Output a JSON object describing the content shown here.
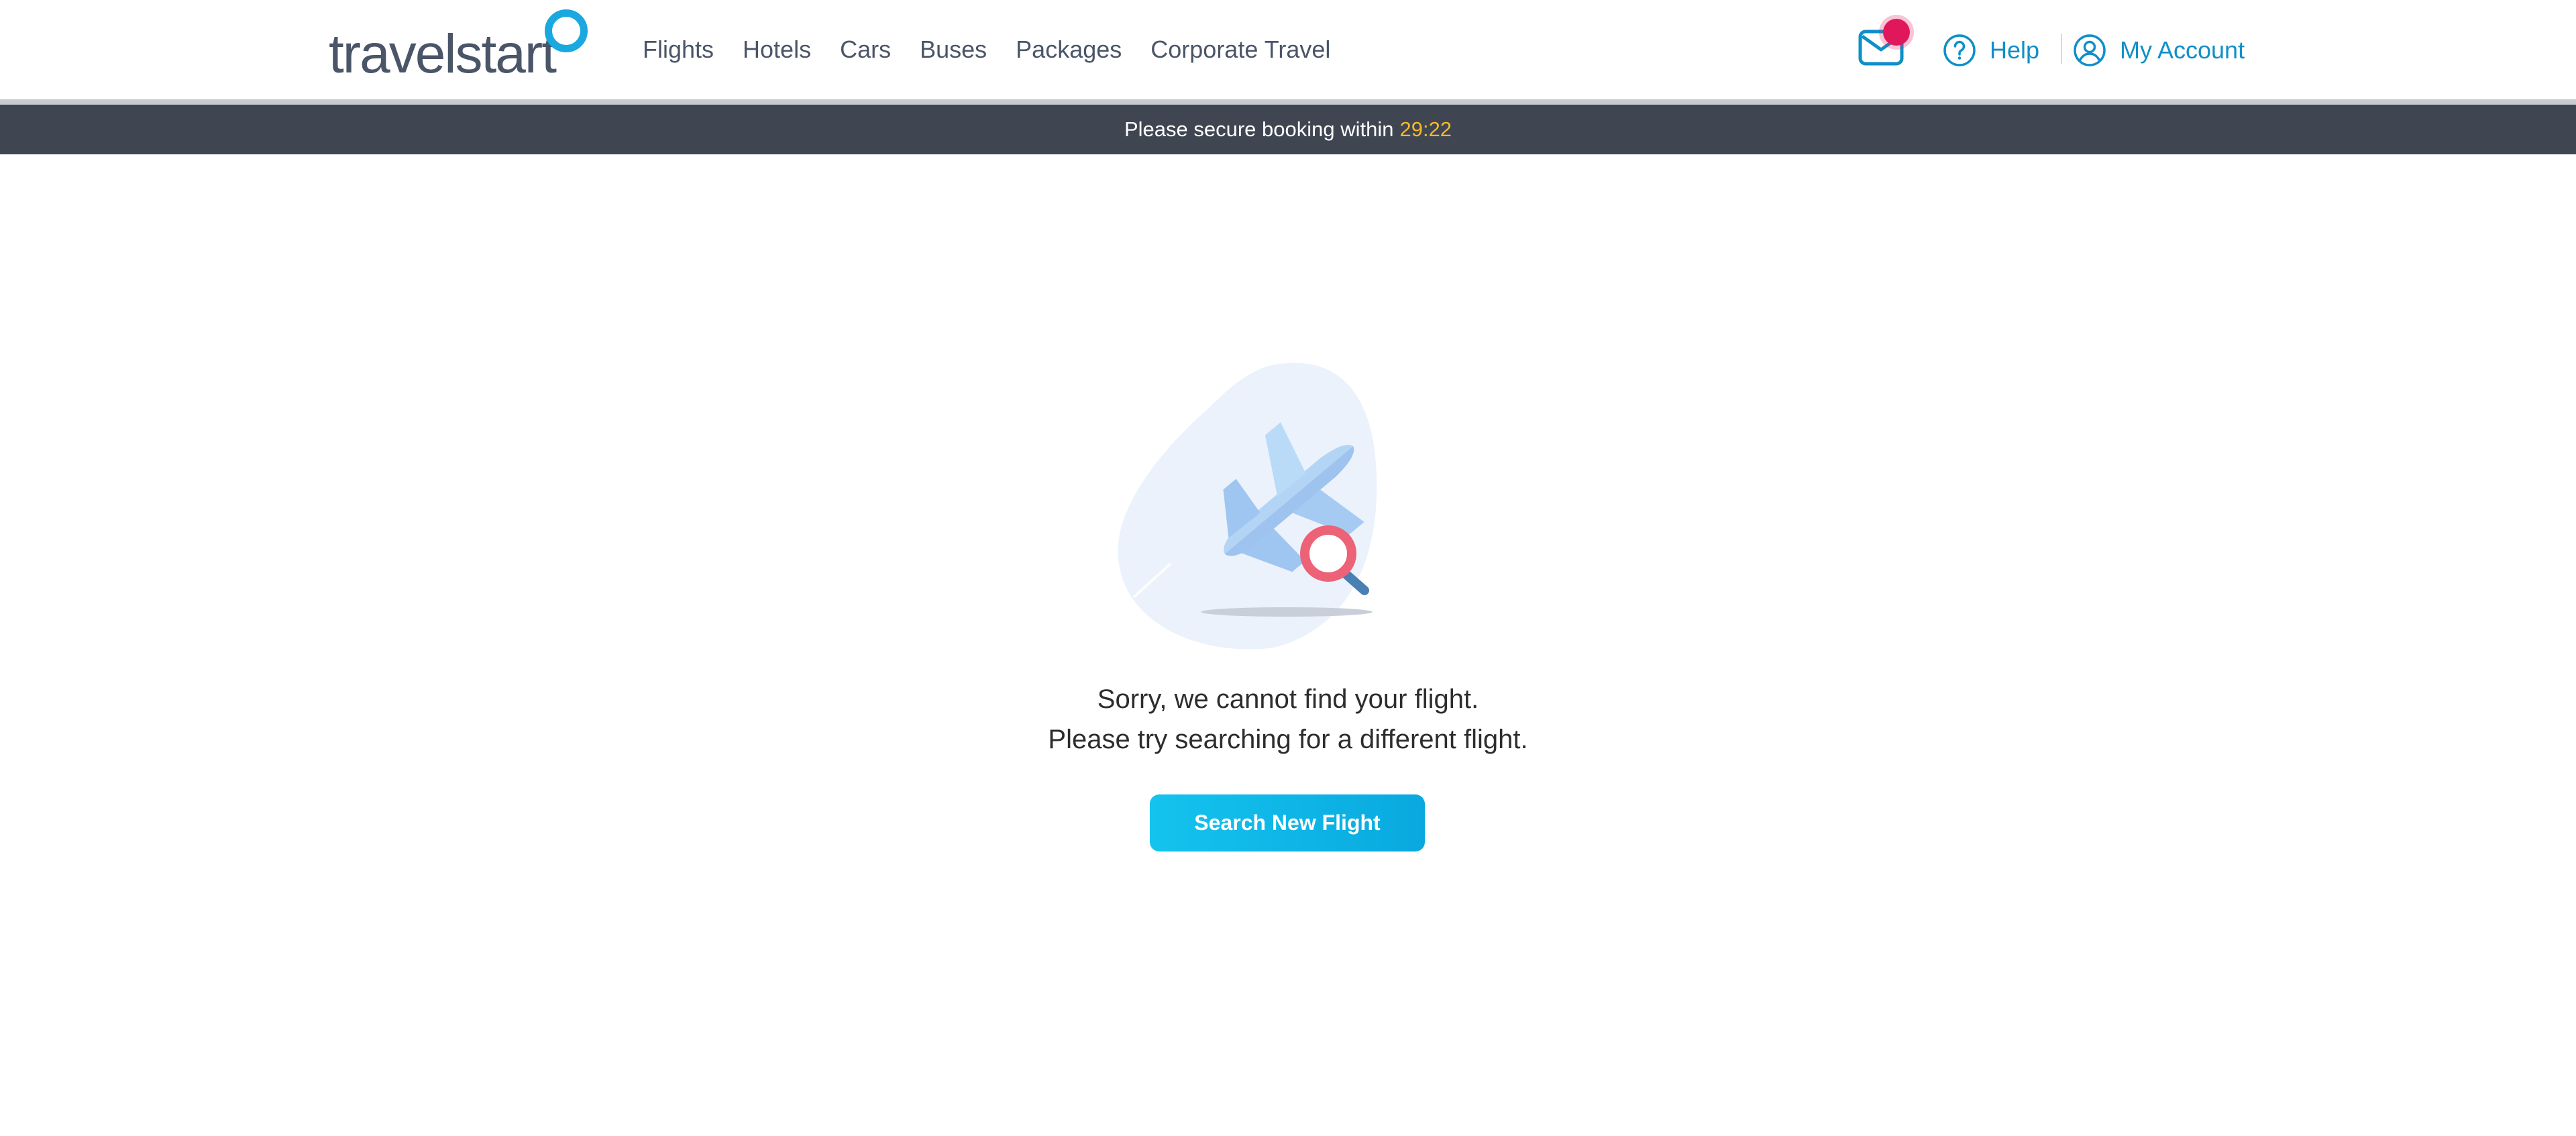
{
  "header": {
    "logo_text": "travelstart",
    "nav": [
      {
        "label": "Flights"
      },
      {
        "label": "Hotels"
      },
      {
        "label": "Cars"
      },
      {
        "label": "Buses"
      },
      {
        "label": "Packages"
      },
      {
        "label": "Corporate Travel"
      }
    ],
    "help_label": "Help",
    "account_label": "My Account"
  },
  "timer": {
    "text": "Please secure booking within",
    "value": "29:22"
  },
  "main": {
    "message_line1": "Sorry, we cannot find your flight.",
    "message_line2": "Please try searching for a different flight.",
    "button_label": "Search New Flight"
  },
  "colors": {
    "brand_blue": "#19a8df",
    "link_blue": "#0f8fc9",
    "timer_bar": "#3f4652",
    "timer_value": "#f6b92b",
    "badge": "#e0175a",
    "button": "#0aaee2"
  },
  "icons": [
    "mail-icon",
    "help-icon",
    "account-icon",
    "plane-search-illustration"
  ]
}
